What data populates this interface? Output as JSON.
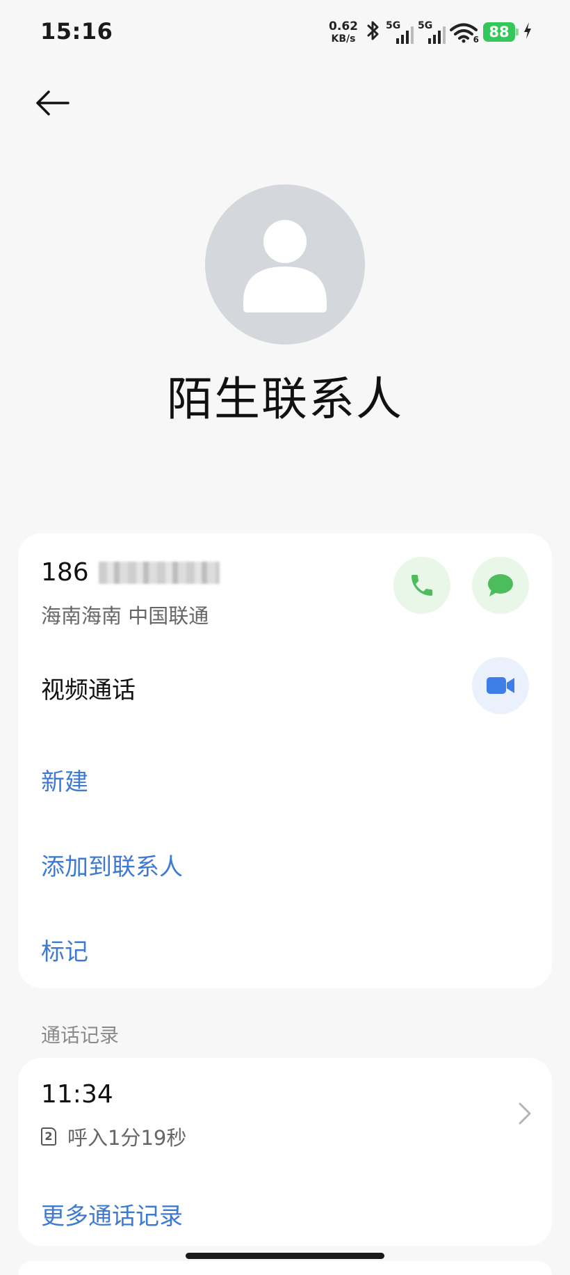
{
  "status_bar": {
    "time": "15:16",
    "net_speed_value": "0.62",
    "net_speed_unit": "KB/s",
    "sim1_tag": "5G",
    "sim2_tag": "5G",
    "wifi_label": "6",
    "battery_level": "88",
    "battery_color": "#34c759"
  },
  "header": {
    "back_icon": "arrow-left-icon"
  },
  "contact": {
    "avatar_icon": "person-silhouette-icon",
    "name": "陌生联系人"
  },
  "phone": {
    "number_prefix": "186",
    "location": "海南海南 中国联通",
    "call_icon": "phone-icon",
    "message_icon": "message-bubble-icon",
    "accent_green": "#4cbc5c"
  },
  "video_call": {
    "label": "视频通话",
    "icon": "video-camera-icon",
    "accent_blue": "#3f7ee8"
  },
  "actions": {
    "new": "新建",
    "add_to_contacts": "添加到联系人",
    "mark": "标记",
    "link_color": "#3e7ad2"
  },
  "call_log": {
    "section_title": "通话记录",
    "entries": [
      {
        "time": "11:34",
        "sim_slot": "2",
        "detail": "呼入1分19秒"
      }
    ],
    "more": "更多通话记录"
  }
}
